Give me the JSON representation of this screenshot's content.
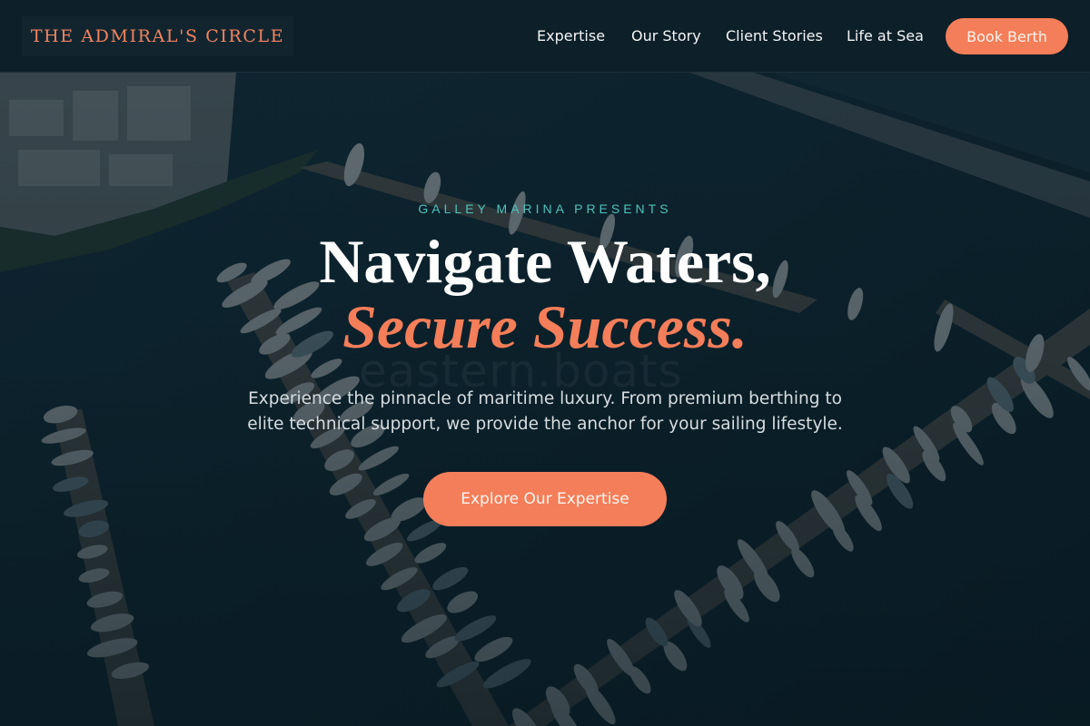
{
  "header": {
    "logo_text": "THE ADMIRAL'S CIRCLE",
    "nav": [
      {
        "label": "Expertise"
      },
      {
        "label": "Our Story"
      },
      {
        "label": "Client Stories"
      },
      {
        "label": "Life at Sea"
      }
    ],
    "cta_label": "Book Berth"
  },
  "hero": {
    "eyebrow": "GALLEY MARINA PRESENTS",
    "headline_line1": "Navigate Waters,",
    "headline_line2": "Secure Success.",
    "subtitle": "Experience the pinnacle of maritime luxury. From premium berthing to elite technical support, we provide the anchor for your sailing lifestyle.",
    "cta_label": "Explore Our Expertise",
    "background_image": "aerial-marina-photo",
    "watermark_text": "eastern.boats"
  },
  "colors": {
    "accent": "#f47e59",
    "eyebrow": "#4fc2bd",
    "header_bg": "#0d1f28",
    "logo": "#f2845f",
    "text": "#ffffff"
  }
}
